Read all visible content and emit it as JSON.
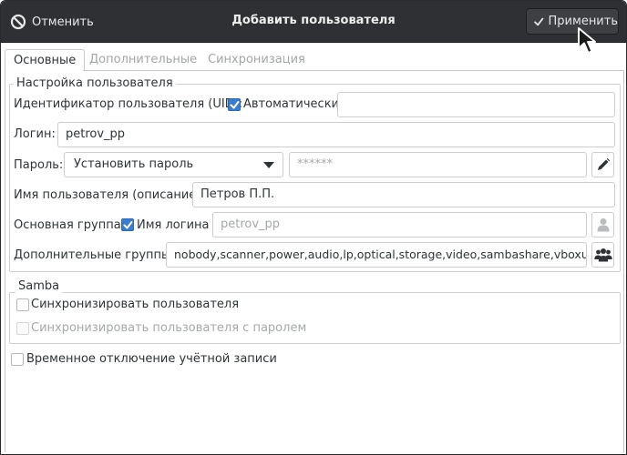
{
  "titlebar": {
    "cancel_label": "Отменить",
    "title": "Добавить пользователя",
    "apply_label": "Применить"
  },
  "tabs": [
    {
      "label": "Основные",
      "active": true
    },
    {
      "label": "Дополнительные",
      "active": false
    },
    {
      "label": "Синхронизация",
      "active": false
    }
  ],
  "user_settings": {
    "frame_title": "Настройка пользователя",
    "uid_label": "Идентификатор пользователя (UID):",
    "uid_auto_label": "Автоматически",
    "uid_auto_checked": true,
    "uid_value": "",
    "login_label": "Логин:",
    "login_value": "petrov_pp",
    "password_label": "Пароль:",
    "password_mode": "Установить пароль",
    "password_value": "******",
    "fullname_label": "Имя пользователя (описание):",
    "fullname_value": "Петров П.П.",
    "primary_group_label": "Основная группа:",
    "primary_group_check_label": "Имя логина",
    "primary_group_checked": true,
    "primary_group_value": "petrov_pp",
    "extra_groups_label": "Дополнительные группы:",
    "extra_groups_value": "nobody,scanner,power,audio,lp,optical,storage,video,sambashare,vboxusers"
  },
  "samba": {
    "frame_title": "Samba",
    "sync_user_label": "Синхронизировать пользователя",
    "sync_user_checked": false,
    "sync_password_label": "Синхронизировать пользователя с паролем",
    "sync_password_checked": false
  },
  "disable_account": {
    "label": "Временное отключение учётной записи",
    "checked": false
  },
  "colors": {
    "titlebar": "#2f3033",
    "accent": "#3d7cc9"
  },
  "icons": {
    "cancel": "cancel-circle-icon",
    "apply": "checkmark-icon",
    "edit": "pencil-icon",
    "user": "user-icon",
    "groups": "users-group-icon"
  }
}
